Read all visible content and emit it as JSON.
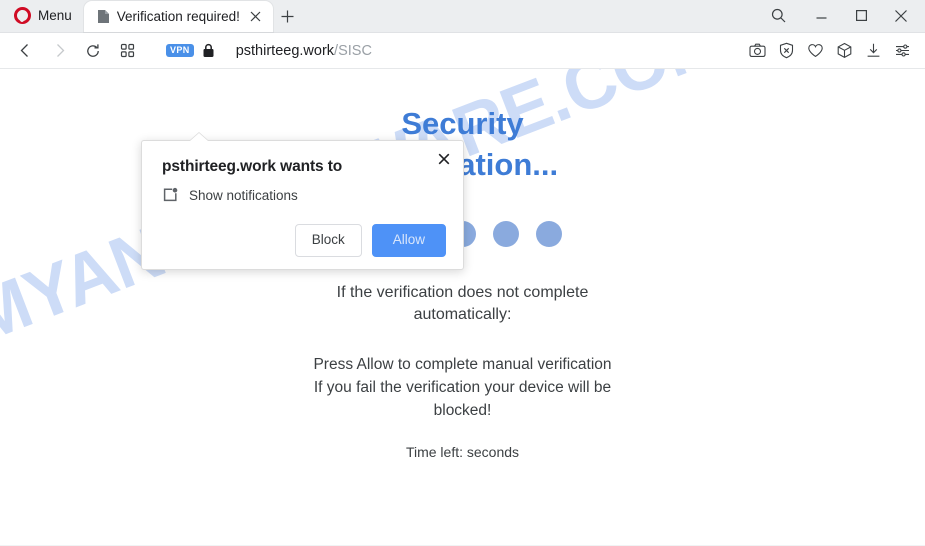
{
  "browser": {
    "menu_label": "Menu",
    "tab": {
      "title": "Verification required!",
      "favicon": "page-icon",
      "close": "×"
    },
    "new_tab": "+",
    "window_controls": {
      "search": "search-icon",
      "minimize": "minimize-icon",
      "maximize": "maximize-icon",
      "close": "close-icon"
    },
    "navigation": {
      "back": "back-arrow-icon",
      "forward": "forward-arrow-icon",
      "reload": "reload-icon",
      "workspaces": "workspaces-icon"
    },
    "address": {
      "vpn_badge": "VPN",
      "lock": "lock-icon",
      "domain": "psthirteeg.work",
      "path": "/SISC"
    },
    "toolbar_icons": [
      "snapshot-camera-icon",
      "ad-blocker-shield-icon",
      "heart-icon",
      "package-cube-icon",
      "download-icon",
      "easy-setup-sliders-icon"
    ]
  },
  "page": {
    "heading_line1": "Security",
    "heading_line2": "verification...",
    "dots": {
      "count": 5,
      "active_index": 1,
      "color": "#8aaade",
      "active_color": "#2a5bc8"
    },
    "paragraph1": "If the verification does not complete automatically:",
    "paragraph2_line1": "Press Allow to complete manual verification",
    "paragraph2_line2": "If you fail the verification your device will be blocked!",
    "time_left": "Time left: seconds",
    "watermark": "MYANTISPYWARE.COM",
    "heading_color": "#3e7cd6"
  },
  "permission_dialog": {
    "title": "psthirteeg.work wants to",
    "request_icon": "notification-square-icon",
    "request_label": "Show notifications",
    "block_label": "Block",
    "allow_label": "Allow",
    "close_label": "×",
    "allow_color": "#4e92f7"
  }
}
